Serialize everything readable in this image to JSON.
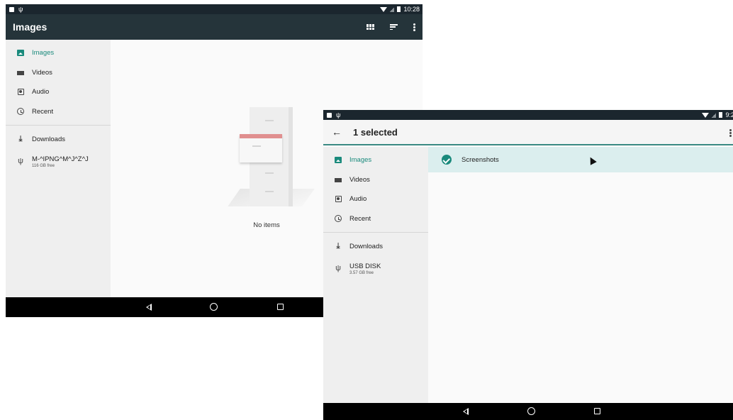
{
  "screen1": {
    "status": {
      "time": "10:28"
    },
    "title": "Images",
    "actions": [
      "grid-view-icon",
      "sort-icon",
      "more-options-icon"
    ],
    "drawer": {
      "roots": [
        {
          "label": "Images",
          "icon": "image-icon",
          "active": true
        },
        {
          "label": "Videos",
          "icon": "video-icon",
          "active": false
        },
        {
          "label": "Audio",
          "icon": "audio-icon",
          "active": false
        },
        {
          "label": "Recent",
          "icon": "clock-icon",
          "active": false
        }
      ],
      "devices": [
        {
          "label": "Downloads",
          "icon": "download-icon"
        },
        {
          "label": "M-^IPNG^M^J^Z^J",
          "subtitle": "116 GB free",
          "icon": "usb-icon"
        }
      ]
    },
    "empty_text": "No items"
  },
  "screen2": {
    "status": {
      "time": "9:2"
    },
    "title": "1 selected",
    "drawer": {
      "roots": [
        {
          "label": "Images",
          "icon": "image-icon",
          "active": true
        },
        {
          "label": "Videos",
          "icon": "video-icon",
          "active": false
        },
        {
          "label": "Audio",
          "icon": "audio-icon",
          "active": false
        },
        {
          "label": "Recent",
          "icon": "clock-icon",
          "active": false
        }
      ],
      "devices": [
        {
          "label": "Downloads",
          "icon": "download-icon"
        },
        {
          "label": "USB DISK",
          "subtitle": "3.57 GB free",
          "icon": "usb-icon"
        }
      ]
    },
    "rows": [
      {
        "label": "Screenshots",
        "selected": true
      }
    ]
  },
  "colors": {
    "accent": "#1a8a7c",
    "appbar_dark": "#25343a",
    "statusbar": "#1b262e",
    "selected_row": "#dbeeee"
  }
}
